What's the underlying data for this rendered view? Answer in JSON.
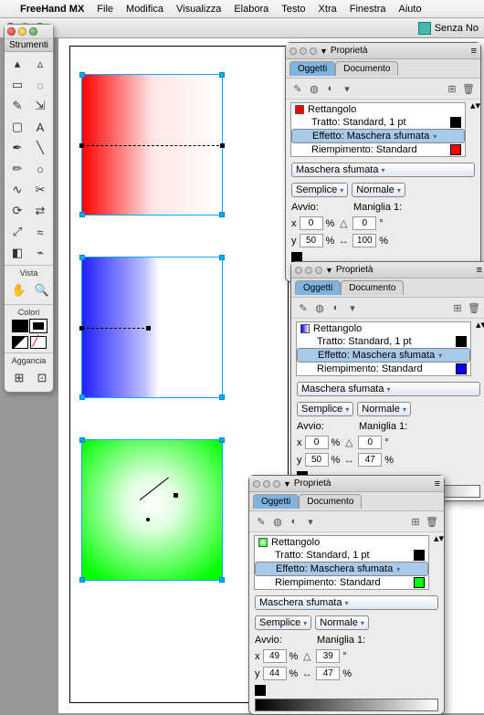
{
  "menubar": {
    "app": "FreeHand MX",
    "items": [
      "File",
      "Modifica",
      "Visualizza",
      "Elabora",
      "Testo",
      "Xtra",
      "Finestra",
      "Aiuto"
    ]
  },
  "document": {
    "title": "Senza No"
  },
  "tools": {
    "title": "Strumenti",
    "sections": {
      "view": "Vista",
      "colors": "Colori",
      "snap": "Aggancia"
    }
  },
  "panels": [
    {
      "title": "Proprietà",
      "tabs": [
        "Oggetti",
        "Documento"
      ],
      "object": {
        "type": "Rettangolo",
        "stroke": "Tratto: Standard, 1 pt",
        "effect": "Effetto: Maschera sfumata",
        "fill": "Riempimento: Standard",
        "fill_color": "#ff0000",
        "stroke_color": "#000000"
      },
      "mask": {
        "type": "Maschera sfumata",
        "mode1": "Semplice",
        "mode2": "Normale"
      },
      "avvio": "Avvio:",
      "maniglia": "Maniglia 1:",
      "x": "0",
      "y": "50",
      "angle": "0",
      "len": "100"
    },
    {
      "title": "Proprietà",
      "tabs": [
        "Oggetti",
        "Documento"
      ],
      "object": {
        "type": "Rettangolo",
        "stroke": "Tratto: Standard, 1 pt",
        "effect": "Effetto: Maschera sfumata",
        "fill": "Riempimento: Standard",
        "fill_color": "#0000ff",
        "stroke_color": "#000000"
      },
      "mask": {
        "type": "Maschera sfumata",
        "mode1": "Semplice",
        "mode2": "Normale"
      },
      "avvio": "Avvio:",
      "maniglia": "Maniglia 1:",
      "x": "0",
      "y": "50",
      "angle": "0",
      "len": "47"
    },
    {
      "title": "Proprietà",
      "tabs": [
        "Oggetti",
        "Documento"
      ],
      "object": {
        "type": "Rettangolo",
        "stroke": "Tratto: Standard, 1 pt",
        "effect": "Effetto: Maschera sfumata",
        "fill": "Riempimento: Standard",
        "fill_color": "#00ff00",
        "stroke_color": "#000000"
      },
      "mask": {
        "type": "Maschera sfumata",
        "mode1": "Semplice",
        "mode2": "Normale"
      },
      "avvio": "Avvio:",
      "maniglia": "Maniglia 1:",
      "x": "49",
      "y": "44",
      "angle": "39",
      "len": "47"
    }
  ],
  "labels": {
    "x": "x",
    "y": "y",
    "pct": "%",
    "deg": "°"
  }
}
